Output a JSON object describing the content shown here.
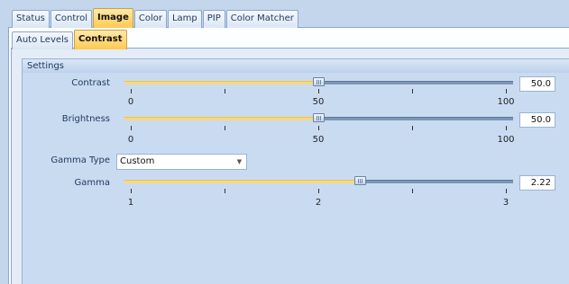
{
  "outer_tabs": [
    "Status",
    "Control",
    "Image",
    "Color",
    "Lamp",
    "PIP",
    "Color Matcher"
  ],
  "outer_active": "Image",
  "inner_tabs": [
    "Auto Levels",
    "Contrast"
  ],
  "inner_active": "Contrast",
  "group_title": "Settings",
  "contrast": {
    "label": "Contrast",
    "value": "50.0",
    "level": 0.5,
    "ticks": [
      "0",
      "50",
      "100"
    ]
  },
  "brightness": {
    "label": "Brightness",
    "value": "50.0",
    "level": 0.5,
    "ticks": [
      "0",
      "50",
      "100"
    ]
  },
  "gamma_type": {
    "label": "Gamma Type",
    "selected": "Custom"
  },
  "gamma": {
    "label": "Gamma",
    "value": "2.22",
    "level": 0.61,
    "ticks": [
      "1",
      "2",
      "3"
    ]
  },
  "colors": {
    "accent_fill": "#f7d97c",
    "active_tab": "#ffc952",
    "panel_blue": "#c9dbf1"
  },
  "icons": {
    "combo_arrow": "chevron-down-icon",
    "slider_thumb": "grip-icon"
  }
}
